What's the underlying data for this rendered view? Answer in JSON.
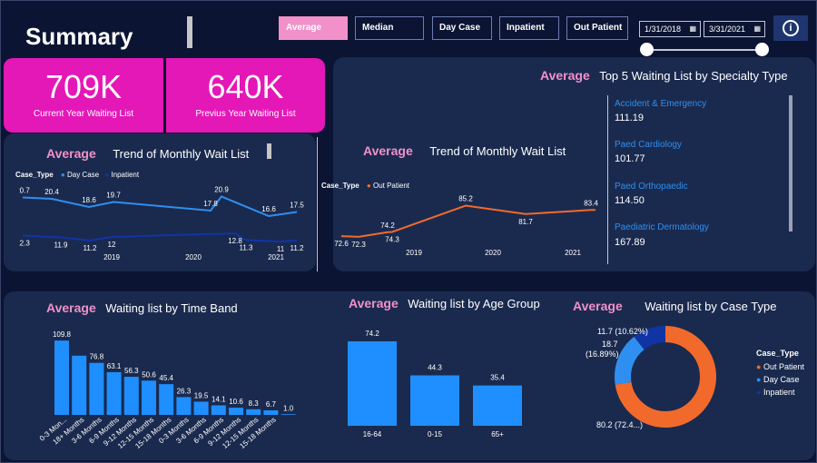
{
  "header": {
    "title": "Summary",
    "buttons": [
      "Average",
      "Median",
      "Day Case",
      "Inpatient",
      "Out Patient"
    ],
    "date_start": "1/31/2018",
    "date_end": "3/31/2021",
    "info_icon": "info-icon"
  },
  "kpis": [
    {
      "value": "709K",
      "label": "Current Year Waiting List"
    },
    {
      "value": "640K",
      "label": "Previus Year Waiting List"
    }
  ],
  "measure_label": "Average",
  "specialty": {
    "title": "Top 5 Waiting List by Specialty Type",
    "items": [
      {
        "name": "Accident & Emergency",
        "value": "111.19"
      },
      {
        "name": "Paed Cardiology",
        "value": "101.77"
      },
      {
        "name": "Paed Orthopaedic",
        "value": "114.50"
      },
      {
        "name": "Paediatric Dermatology",
        "value": "167.89"
      }
    ]
  },
  "trend_left": {
    "title": "Trend of Monthly Wait List",
    "legend_title": "Case_Type",
    "legend": [
      "Day Case",
      "Inpatient"
    ],
    "years": [
      "2019",
      "2020",
      "2021"
    ]
  },
  "trend_right": {
    "title": "Trend of Monthly Wait List",
    "legend_title": "Case_Type",
    "legend": [
      "Out Patient"
    ],
    "years": [
      "2019",
      "2020",
      "2021"
    ]
  },
  "time_band": {
    "title": "Waiting list by Time Band"
  },
  "age_group": {
    "title": "Waiting list by  Age Group"
  },
  "case_type": {
    "title": "Waiting list by Case Type",
    "legend_title": "Case_Type",
    "legend": [
      "Out Patient",
      "Day Case",
      "Inpatient"
    ],
    "labels": [
      "11.7 (10.62%)",
      "18.7",
      "(16.89%)",
      "80.2 (72.4...)"
    ]
  },
  "colors": {
    "accent": "#f291c9",
    "kpi": "#e417b7",
    "day_case": "#2f8ff0",
    "inpatient": "#1034a6",
    "out_patient": "#f26a2b",
    "bar": "#1f8fff"
  },
  "chart_data": [
    {
      "type": "line",
      "title": "Trend of Monthly Wait List",
      "x": [
        "2019",
        "2020",
        "2021"
      ],
      "series": [
        {
          "name": "Day Case",
          "values": [
            20.7,
            20.4,
            18.6,
            19.7,
            17.8,
            20.9,
            16.6,
            17.5
          ]
        },
        {
          "name": "Inpatient",
          "values": [
            12.3,
            11.9,
            11.2,
            12.0,
            12.8,
            11.3,
            11.0,
            11.2
          ]
        }
      ]
    },
    {
      "type": "line",
      "title": "Trend of Monthly Wait List",
      "x": [
        "2019",
        "2020",
        "2021"
      ],
      "series": [
        {
          "name": "Out Patient",
          "values": [
            72.6,
            72.3,
            74.2,
            74.3,
            85.2,
            81.7,
            83.4
          ]
        }
      ]
    },
    {
      "type": "bar",
      "title": "Waiting list by Time Band",
      "categories": [
        "0-3 Mon...",
        "18+ Months",
        "3-6 Months",
        "6-9 Months",
        "9-12 Months",
        "12-15 Months",
        "15-18 Months",
        "0-3 Months",
        "3-6 Months",
        "6-9 Months",
        "9-12 Months",
        "12-15 Months",
        "15-18 Months",
        ""
      ],
      "values": [
        109.8,
        87.5,
        76.8,
        63.1,
        56.3,
        50.6,
        45.4,
        26.3,
        19.5,
        14.1,
        10.6,
        8.3,
        6.7,
        1.0
      ],
      "value_labels": [
        "109.8",
        "",
        "76.8",
        "63.1",
        "56.3",
        "50.6",
        "45.4",
        "26.3",
        "19.5",
        "14.1",
        "10.6",
        "8.3",
        "6.7",
        "1.0"
      ]
    },
    {
      "type": "bar",
      "title": "Waiting list by  Age Group",
      "categories": [
        "16-64",
        "0-15",
        "65+"
      ],
      "values": [
        74.2,
        44.3,
        35.4
      ]
    },
    {
      "type": "pie",
      "title": "Waiting list by Case Type",
      "categories": [
        "Out Patient",
        "Day Case",
        "Inpatient"
      ],
      "values": [
        80.2,
        18.7,
        11.7
      ]
    }
  ]
}
